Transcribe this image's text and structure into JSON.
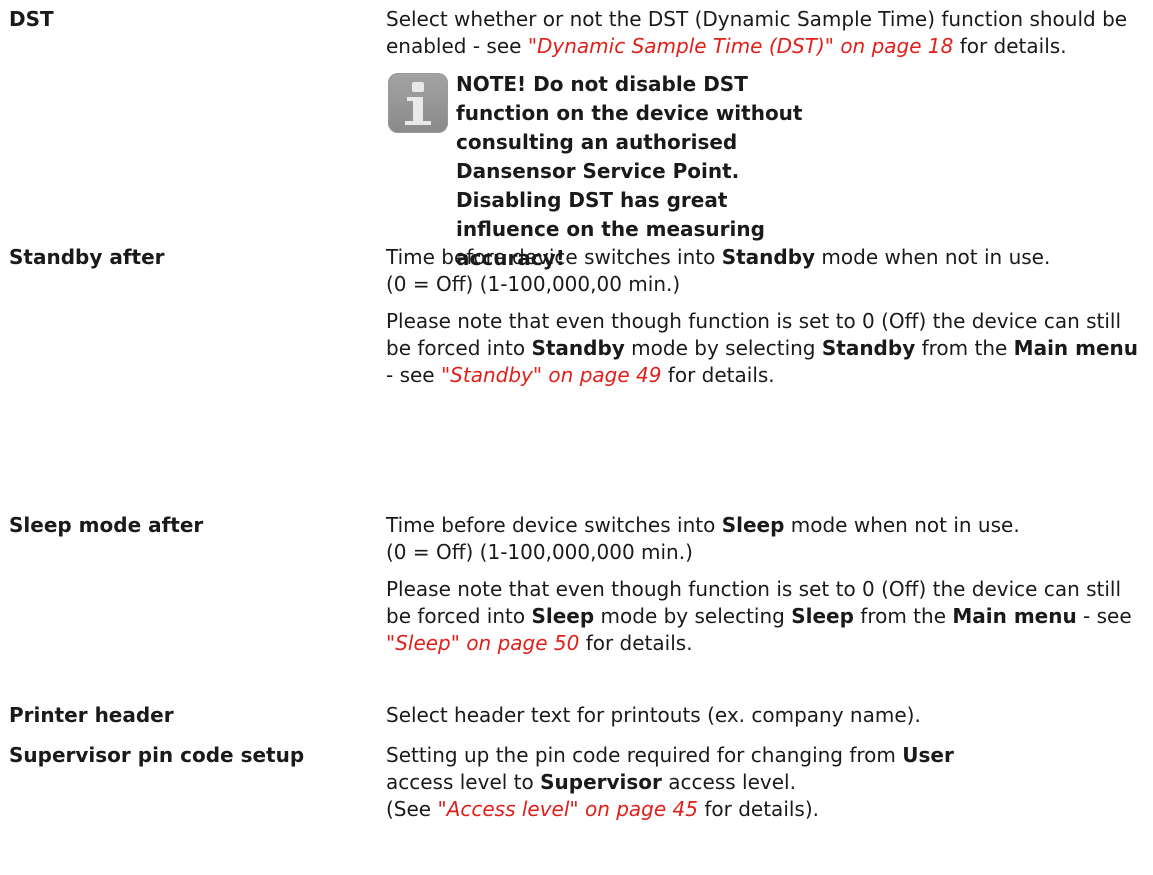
{
  "rows": [
    {
      "term": "DST",
      "p1": {
        "t1": "Select whether or not the DST (Dynamic Sample Time) function should be enabled - see ",
        "link": "\"Dynamic Sample Time (DST)\" on page 18",
        "t2": " for details."
      },
      "note": "NOTE! Do not disable DST function on the device without consulting an authorised Dansensor Service Point. Disabling DST has great influence on the measuring accuracy!"
    },
    {
      "term": "Standby after",
      "p1": {
        "t1": "Time before device switches into ",
        "b1": "Standby",
        "t2": " mode when not in use.",
        "t3": "(0 = Off) (1-100,000,00 min.)"
      },
      "p2": {
        "t1": "Please note that even though function is set to 0 (Off) the device can still be forced into ",
        "b1": "Standby",
        "t2": " mode by selecting ",
        "b2": "Standby",
        "t3": " from the ",
        "b3": "Main menu",
        "t4": " - see ",
        "link": "\"Standby\" on page 49",
        "t5": " for details."
      }
    },
    {
      "term": "Sleep mode after",
      "p1": {
        "t1": "Time before device switches into ",
        "b1": "Sleep",
        "t2": " mode when not in use.",
        "t3": "(0 = Off) (1-100,000,000 min.)"
      },
      "p2": {
        "t1": "Please note that even though function is set to 0 (Off) the device can still be forced into ",
        "b1": "Sleep",
        "t2": " mode by selecting ",
        "b2": "Sleep",
        "t3": " from the ",
        "b3": "Main menu",
        "t4": " - see ",
        "link": "\"Sleep\" on page 50",
        "t5": " for details."
      }
    },
    {
      "term": "Printer header",
      "p1": {
        "t1": "Select header text for printouts (ex. company name)."
      }
    },
    {
      "term": "Supervisor pin code setup",
      "p1": {
        "t1": "Setting up the pin code required for changing from ",
        "b1": "User",
        "t2": " access level to ",
        "b2": "Supervisor",
        "t3": " access level.",
        "t4": "(See ",
        "link": "\"Access level\" on page 45",
        "t5": " for details)."
      }
    }
  ],
  "colors": {
    "link": "#e0201b",
    "text": "#1a1a1a",
    "icon": "#939393"
  },
  "icons": {
    "note": "info-icon"
  }
}
